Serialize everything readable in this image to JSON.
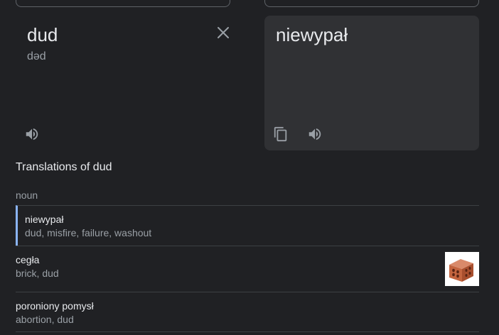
{
  "source": {
    "text": "dud",
    "phonetic": "dəd"
  },
  "target": {
    "text": "niewypał"
  },
  "translations": {
    "heading": "Translations of dud",
    "part_of_speech": "noun",
    "rows": [
      {
        "word": "niewypał",
        "synonyms": "dud, misfire, failure, washout"
      },
      {
        "word": "cegła",
        "synonyms": "brick, dud"
      },
      {
        "word": "poroniony pomysł",
        "synonyms": "abortion, dud"
      }
    ]
  },
  "icons": {
    "clear": "close-icon",
    "listen_source": "speaker-icon",
    "copy": "copy-icon",
    "listen_target": "speaker-icon",
    "brick_image": "brick-image"
  },
  "colors": {
    "background": "#202124",
    "panel": "#303134",
    "accent": "#8ab4f8",
    "text_primary": "#e8eaed",
    "text_secondary": "#9aa0a6"
  }
}
